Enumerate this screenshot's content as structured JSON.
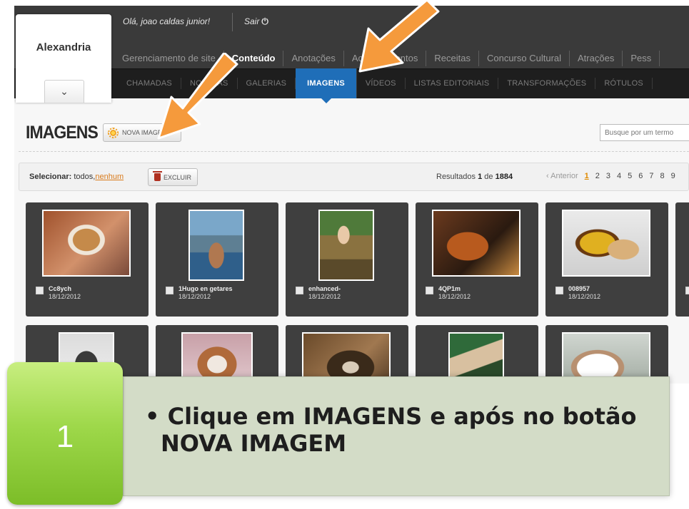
{
  "site": {
    "name": "Alexandria",
    "toggle_icon": "chevron-down-icon"
  },
  "user": {
    "greeting": "Olá, joao caldas junior!",
    "logout_label": "Sair",
    "logout_icon": "power-icon"
  },
  "main_nav": [
    {
      "label": "Gerenciamento de site",
      "active": false
    },
    {
      "label": "Conteúdo",
      "active": true
    },
    {
      "label": "Anotações",
      "active": false
    },
    {
      "label": "Acontecimentos",
      "active": false
    },
    {
      "label": "Receitas",
      "active": false
    },
    {
      "label": "Concurso Cultural",
      "active": false
    },
    {
      "label": "Atrações",
      "active": false
    },
    {
      "label": "Pess",
      "active": false
    }
  ],
  "sub_nav": [
    {
      "label": "CHAMADAS",
      "active": false
    },
    {
      "label": "NOTÍCIAS",
      "active": false
    },
    {
      "label": "GALERIAS",
      "active": false
    },
    {
      "label": "IMAGENS",
      "active": true
    },
    {
      "label": "VÍDEOS",
      "active": false
    },
    {
      "label": "LISTAS EDITORIAIS",
      "active": false
    },
    {
      "label": "TRANSFORMAÇÕES",
      "active": false
    },
    {
      "label": "RÓTULOS",
      "active": false
    }
  ],
  "page": {
    "title": "IMAGENS",
    "new_button": "NOVA IMAGEM",
    "search_placeholder": "Busque por um termo"
  },
  "actions": {
    "select_label": "Selecionar:",
    "select_all": "todos",
    "select_none": "nenhum",
    "delete_button": "EXCLUIR",
    "results_prefix": "Resultados",
    "results_from": "1",
    "results_of": "de",
    "results_total": "1884",
    "prev_label": "‹ Anterior",
    "pages": [
      "1",
      "2",
      "3",
      "4",
      "5",
      "6",
      "7",
      "8",
      "9"
    ],
    "current_page": "1"
  },
  "images": [
    {
      "name": "Cc8ych",
      "date": "18/12/2012"
    },
    {
      "name": "1Hugo en getares",
      "date": "18/12/2012"
    },
    {
      "name": "enhanced-",
      "date": "18/12/2012"
    },
    {
      "name": "4QP1m",
      "date": "18/12/2012"
    },
    {
      "name": "008957",
      "date": "18/12/2012"
    },
    {
      "name": "",
      "date": ""
    },
    {
      "name": "",
      "date": ""
    },
    {
      "name": "",
      "date": ""
    },
    {
      "name": "",
      "date": ""
    },
    {
      "name": "",
      "date": ""
    }
  ],
  "slide": {
    "step": "1",
    "instruction": "• Clique em IMAGENS e após no botão NOVA IMAGEM"
  },
  "colors": {
    "accent": "#1f6eb8",
    "arrow": "#f59a3c",
    "step": "#8fcc3a",
    "panel": "#d3dcc7"
  }
}
